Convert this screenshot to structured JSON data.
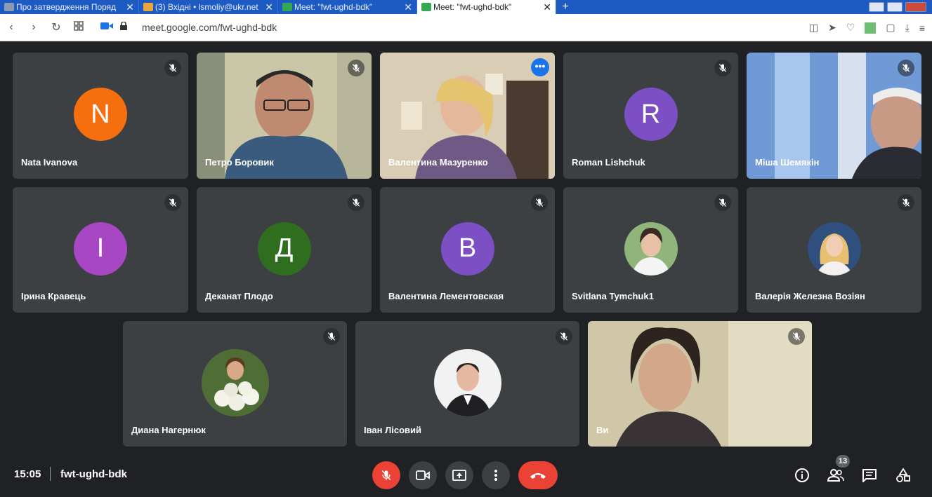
{
  "browser": {
    "tabs": [
      {
        "title": "Про затвердження Поряд",
        "favicon_color": "#8a9bb5",
        "active": false
      },
      {
        "title": "(3) Вхідні • lsmoliy@ukr.net",
        "favicon_color": "#e9a63a",
        "active": false
      },
      {
        "title": "Meet: \"fwt-ughd-bdk\"",
        "favicon_color": "#34a853",
        "active": false
      },
      {
        "title": "Meet: \"fwt-ughd-bdk\"",
        "favicon_color": "#34a853",
        "active": true
      }
    ],
    "new_tab": "+",
    "url": "meet.google.com/fwt-ughd-bdk"
  },
  "participants": [
    {
      "name": "Nata Ivanova",
      "initial": "N",
      "avatar_color": "#f56f0f",
      "type": "initial"
    },
    {
      "name": "Петро Боровик",
      "type": "video"
    },
    {
      "name": "Валентина Мазуренко",
      "type": "video",
      "speaking": true
    },
    {
      "name": "Roman Lishchuk",
      "initial": "R",
      "avatar_color": "#7c4fc4",
      "type": "initial"
    },
    {
      "name": "Міша Шемякін",
      "type": "video"
    },
    {
      "name": "Ірина Кравець",
      "initial": "I",
      "avatar_color": "#a847c4",
      "type": "initial"
    },
    {
      "name": "Деканат Плодо",
      "initial": "Д",
      "avatar_color": "#2f6e1f",
      "type": "initial"
    },
    {
      "name": "Валентина Лементовская",
      "initial": "B",
      "avatar_color": "#7c4fc4",
      "type": "initial"
    },
    {
      "name": "Svitlana Tymchuk1",
      "type": "photo"
    },
    {
      "name": "Валерія Железна Возіян",
      "type": "photo"
    },
    {
      "name": "Диана Нагернюк",
      "type": "photo"
    },
    {
      "name": "Іван Лісовий",
      "type": "photo"
    },
    {
      "name": "Ви",
      "type": "video"
    }
  ],
  "bottom_bar": {
    "time": "15:05",
    "meeting_code": "fwt-ughd-bdk",
    "participant_count": "13",
    "more_symbol": "•••"
  }
}
